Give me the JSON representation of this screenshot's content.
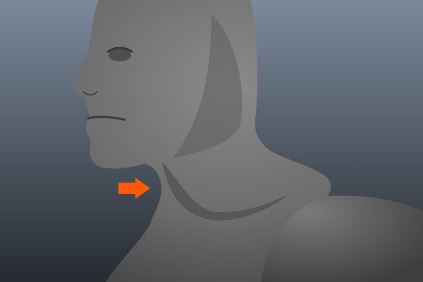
{
  "scene": {
    "subject": "3d-head-model",
    "colors": {
      "background_top": "#7d8a9c",
      "background_bottom": "#262b31",
      "model_light": "#8a8a8a",
      "model_mid": "#6c6c6c",
      "model_dark": "#3e3e3e",
      "arrow": "#ff5a0a"
    },
    "annotation": {
      "icon": "arrow-right-icon"
    }
  }
}
